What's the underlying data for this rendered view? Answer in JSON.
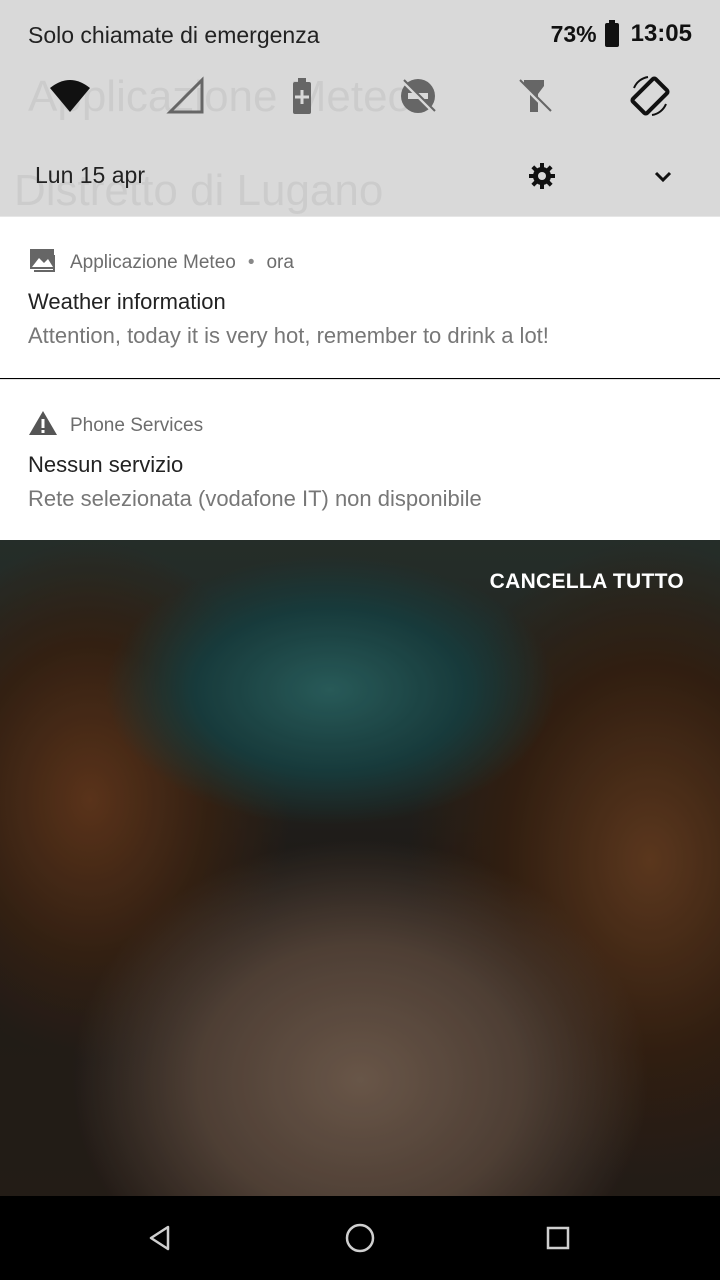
{
  "status_bar": {
    "carrier_text": "Solo chiamate di emergenza",
    "battery_percent": "73%",
    "time": "13:05"
  },
  "quick_settings": {
    "background_app_title": "Applicazione Meteo",
    "background_location": "Distretto di Lugano",
    "tiles": [
      "wifi-icon",
      "cell-signal-icon",
      "battery-saver-icon",
      "do-not-disturb-off-icon",
      "flashlight-off-icon",
      "auto-rotate-icon"
    ],
    "date": "Lun 15 apr"
  },
  "notifications": [
    {
      "app": "Applicazione Meteo",
      "separator": "•",
      "time": "ora",
      "title": "Weather information",
      "body": "Attention, today it is very hot, remember to drink a lot!",
      "icon": "image-icon"
    },
    {
      "app": "Phone Services",
      "title": "Nessun servizio",
      "body": "Rete selezionata (vodafone IT) non disponibile",
      "icon": "warning-icon"
    }
  ],
  "clear_all_label": "CANCELLA TUTTO",
  "colors": {
    "panel_bg": "#d9d9d9",
    "notification_bg": "#ffffff",
    "secondary_text": "#777777",
    "nav_bg": "#000000"
  }
}
